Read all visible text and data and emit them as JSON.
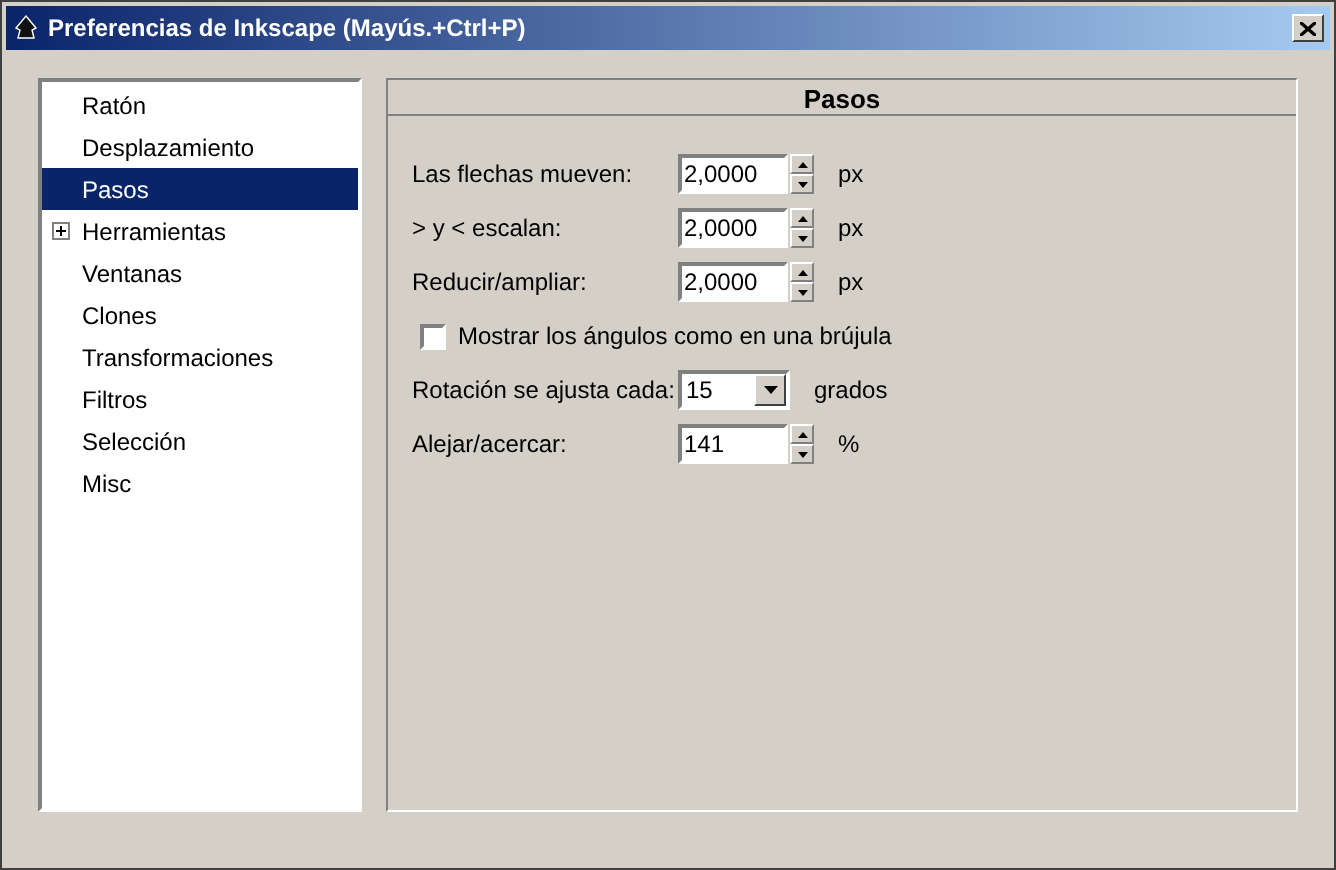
{
  "window": {
    "title": "Preferencias de Inkscape (Mayús.+Ctrl+P)"
  },
  "sidebar": {
    "items": [
      {
        "label": "Ratón",
        "selected": false
      },
      {
        "label": "Desplazamiento",
        "selected": false
      },
      {
        "label": "Pasos",
        "selected": true
      },
      {
        "label": "Herramientas",
        "selected": false,
        "expanded": false
      },
      {
        "label": "Ventanas",
        "selected": false
      },
      {
        "label": "Clones",
        "selected": false
      },
      {
        "label": "Transformaciones",
        "selected": false
      },
      {
        "label": "Filtros",
        "selected": false
      },
      {
        "label": "Selección",
        "selected": false
      },
      {
        "label": "Misc",
        "selected": false
      }
    ]
  },
  "panel": {
    "title": "Pasos",
    "rows": [
      {
        "kind": "spin",
        "label": "Las flechas mueven:",
        "value": "2,0000",
        "unit": "px"
      },
      {
        "kind": "spin",
        "label": "> y < escalan:",
        "value": "2,0000",
        "unit": "px"
      },
      {
        "kind": "spin",
        "label": "Reducir/ampliar:",
        "value": "2,0000",
        "unit": "px"
      },
      {
        "kind": "checkbox",
        "label": "Mostrar los ángulos como en una brújula",
        "checked": false
      },
      {
        "kind": "combo",
        "label": "Rotación se ajusta cada:",
        "value": "15",
        "unit": "grados"
      },
      {
        "kind": "spin",
        "label": "Alejar/acercar:",
        "value": "141",
        "unit": "%"
      }
    ]
  }
}
